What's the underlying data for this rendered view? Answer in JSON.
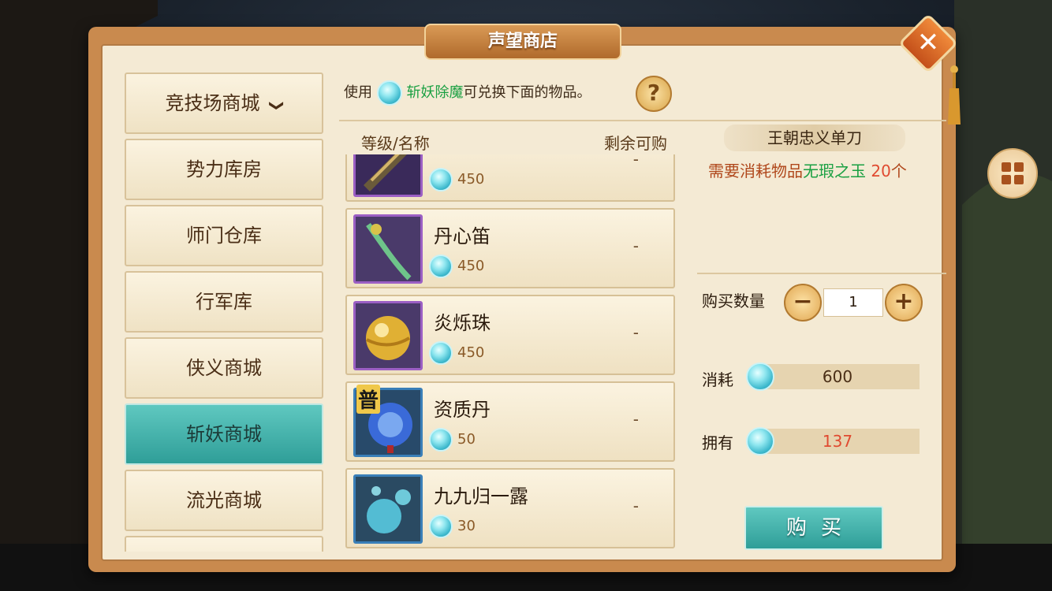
{
  "window": {
    "title": "声望商店",
    "close_label": "✕"
  },
  "colors": {
    "accent_teal": "#2f9e98",
    "frame_orange": "#c98a4e",
    "parchment": "#f4ead4",
    "green_text": "#1aa042",
    "red_text": "#e04a30"
  },
  "tabs": [
    {
      "label": "竞技场商城",
      "chevron": "❯",
      "active": false
    },
    {
      "label": "势力库房",
      "active": false
    },
    {
      "label": "师门仓库",
      "active": false
    },
    {
      "label": "行军库",
      "active": false
    },
    {
      "label": "侠义商城",
      "active": false
    },
    {
      "label": "斩妖商城",
      "active": true
    },
    {
      "label": "流光商城",
      "active": false
    },
    {
      "label": "",
      "active": false
    }
  ],
  "info": {
    "prefix": "使用",
    "currency": "斩妖除魔",
    "suffix": "可兑换下面的物品。",
    "help_label": "?"
  },
  "list_header": {
    "col1": "等级/名称",
    "col2": "剩余可购"
  },
  "items": [
    {
      "name": "",
      "price": "450",
      "remaining": "-",
      "icon": "blade-icon"
    },
    {
      "name": "丹心笛",
      "price": "450",
      "remaining": "-",
      "icon": "flute-icon"
    },
    {
      "name": "炎烁珠",
      "price": "450",
      "remaining": "-",
      "icon": "golden-orb-icon"
    },
    {
      "name": "资质丹",
      "price": "50",
      "remaining": "-",
      "icon": "pill-icon",
      "badge": "普"
    },
    {
      "name": "九九归一露",
      "price": "30",
      "remaining": "-",
      "icon": "bubbles-icon"
    }
  ],
  "detail": {
    "title": "王朝忠义单刀",
    "req_prefix": "需要消耗物品",
    "req_item": "无瑕之玉",
    "req_count": "20",
    "req_unit": "个",
    "qty_label": "购买数量",
    "qty_minus": "−",
    "qty_plus": "+",
    "qty_value": "1",
    "cost_label": "消耗",
    "cost_value": "600",
    "own_label": "拥有",
    "own_value": "137",
    "buy_label": "购买"
  }
}
